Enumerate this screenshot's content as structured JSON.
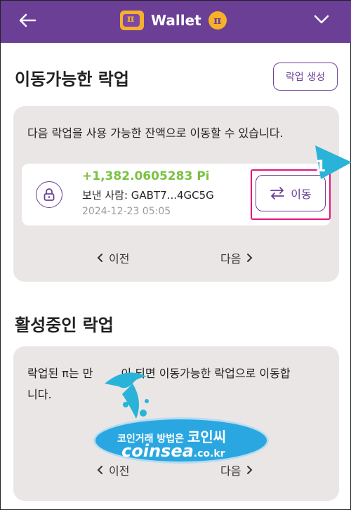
{
  "header": {
    "title": "Wallet",
    "pi_symbol": "π",
    "icons": [
      "back-arrow-icon",
      "wallet-icon",
      "pi-coin-icon",
      "chevron-down-icon"
    ]
  },
  "movable": {
    "title": "이동가능한 락업",
    "create_button": "락업 생성",
    "description": "다음 락업을 사용 가능한 잔액으로 이동할 수 있습니다.",
    "item": {
      "amount": "+1,382.0605283 Pi",
      "sender": "보낸 사람: GABT7...4GC5G",
      "date": "2024-12-23 05:05",
      "move_label": "이동"
    },
    "pager": {
      "prev": "이전",
      "next": "다음"
    }
  },
  "active": {
    "title": "활성중인 락업",
    "description_line1": "락업된 π는 만",
    "description_line1b": "이 되면 이동가능한 락업으로 이동합",
    "description_line2": "니다.",
    "pager": {
      "prev": "이전",
      "next": "다음"
    }
  },
  "callout": {
    "number": "1"
  },
  "watermark": {
    "line1_small": "코인거래 방법은",
    "line1_big": "코인씨",
    "line2_main": "coinsea",
    "line2_suffix": ".co.kr"
  },
  "colors": {
    "header_bg": "#6b3f96",
    "accent_purple": "#6b3f96",
    "amount_green": "#7bc142",
    "highlight_pink": "#e5167d",
    "card_bg": "#eae6e6",
    "pi_gold": "#f7b02a",
    "callout_cyan": "#2ab3d8"
  }
}
